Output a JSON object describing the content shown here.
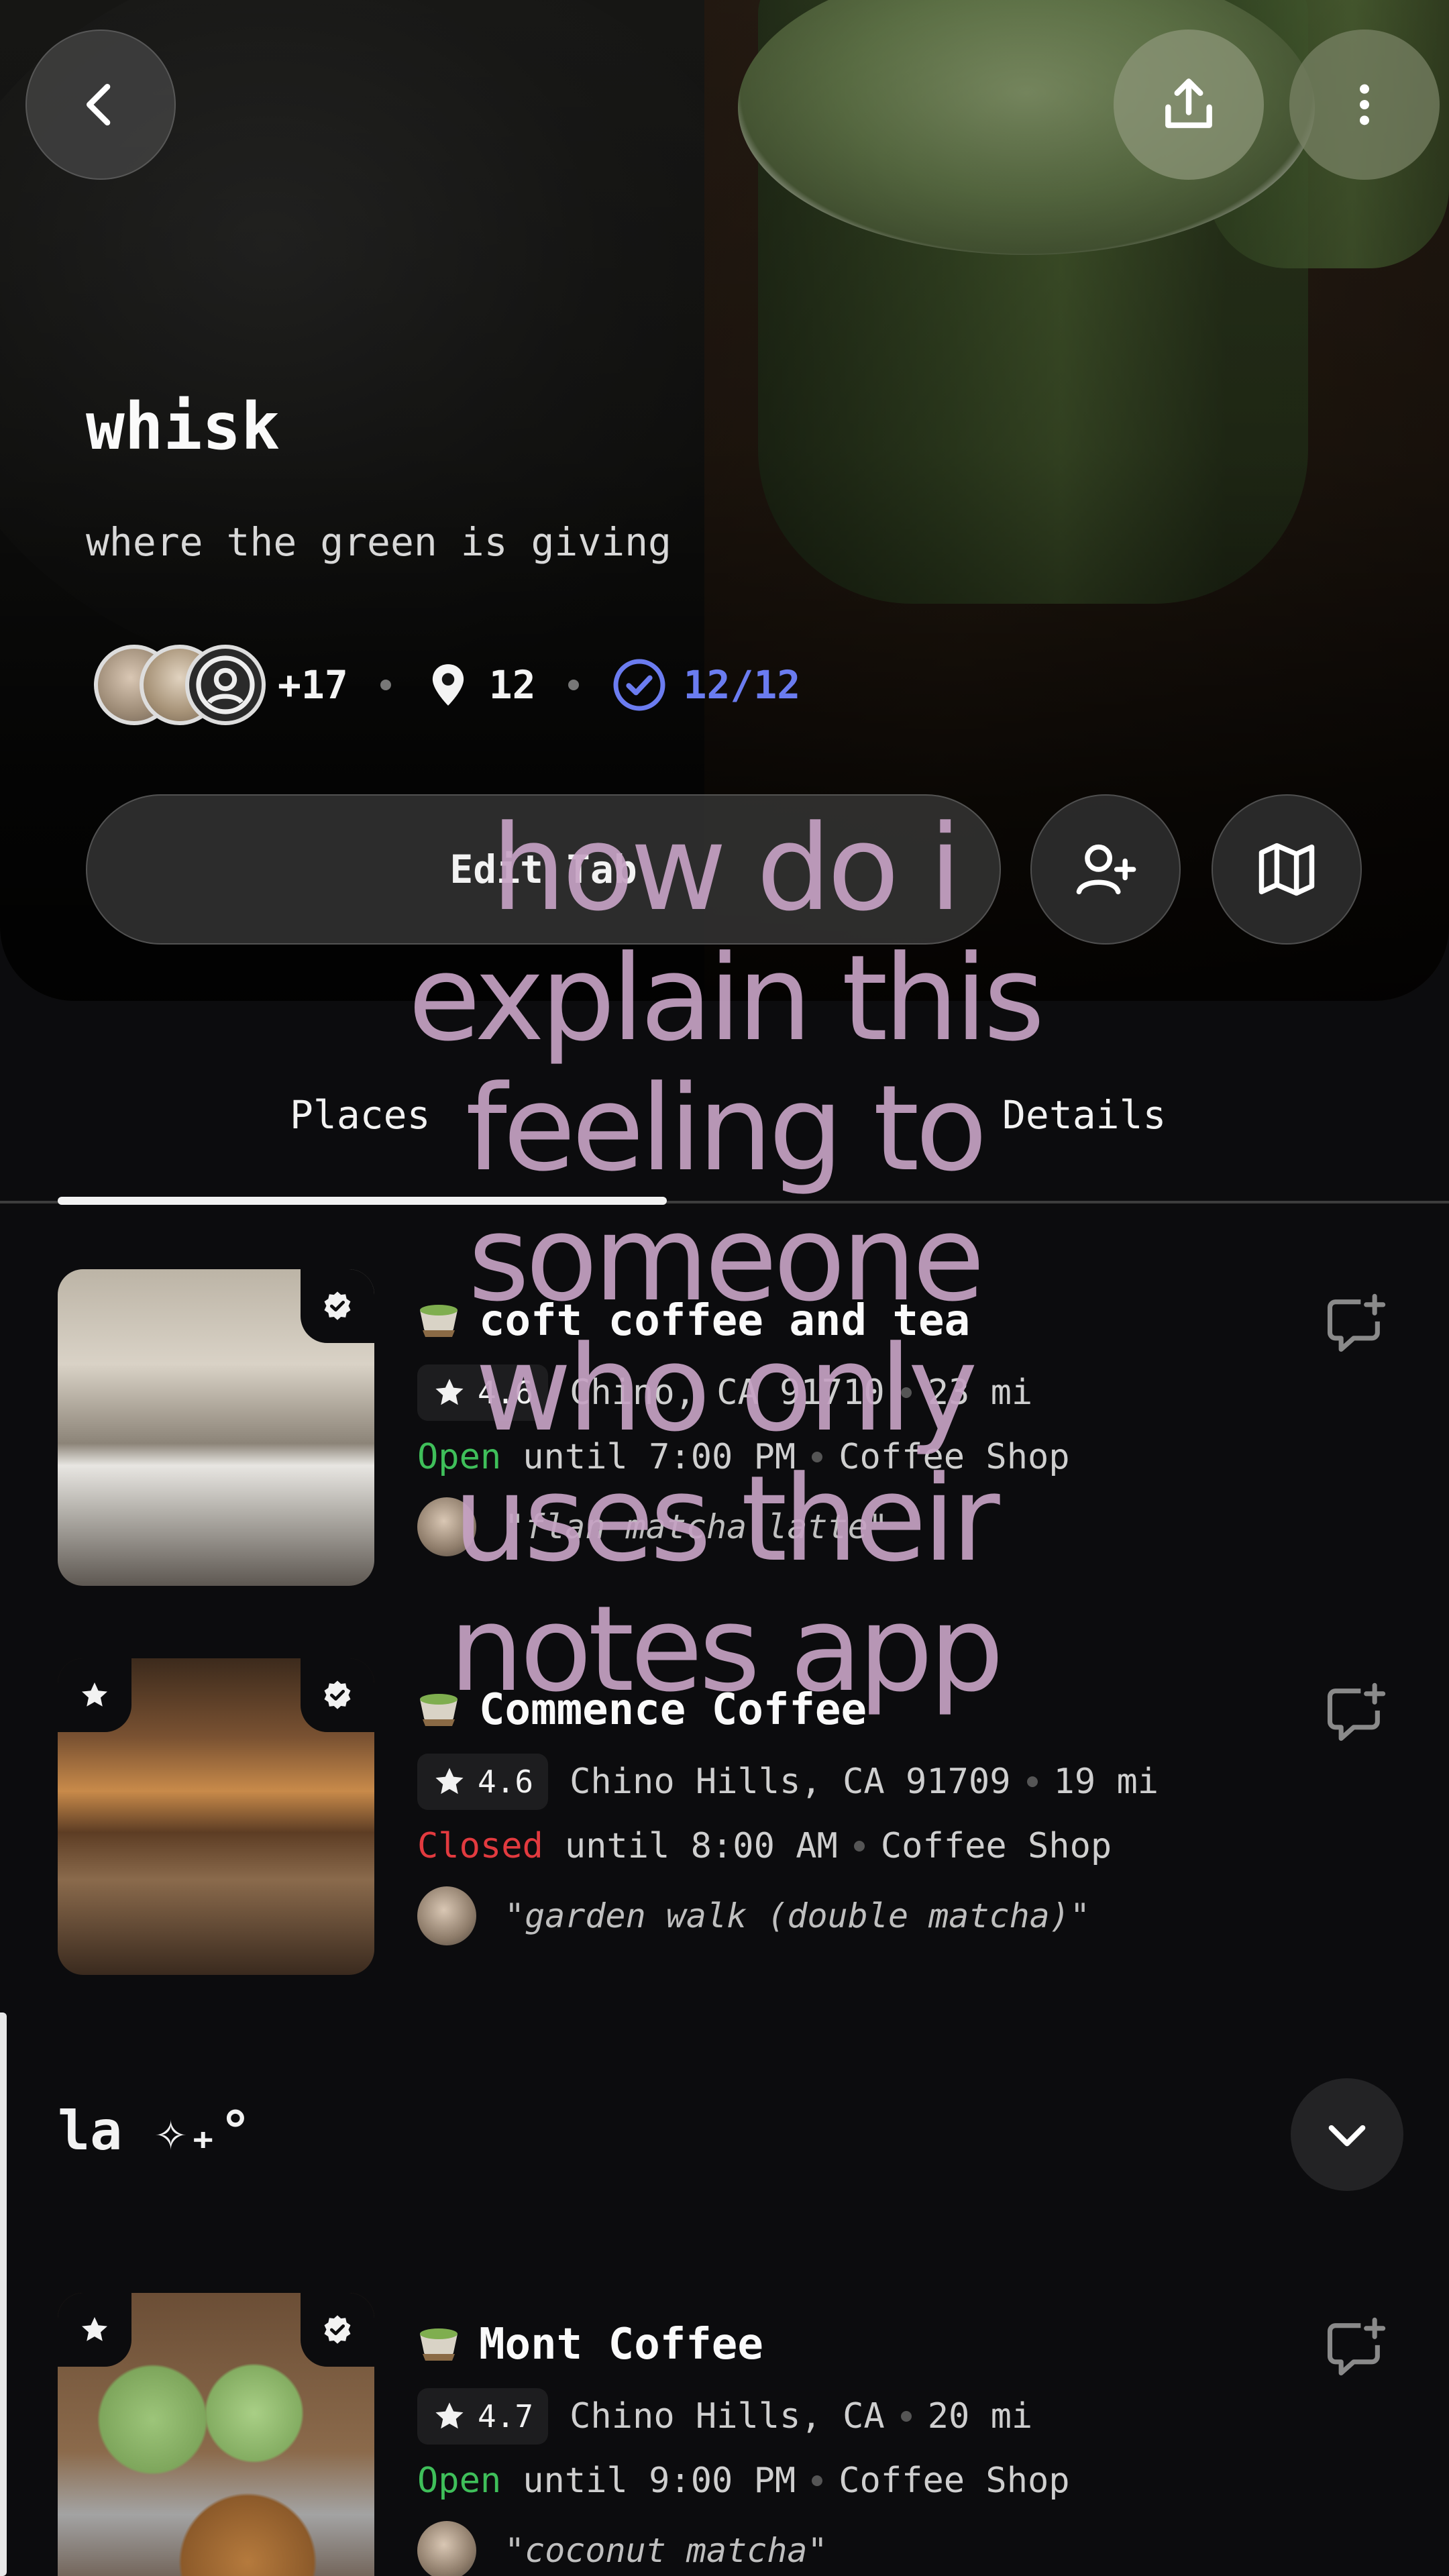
{
  "header": {
    "title": "whisk",
    "subtitle": "where the green is giving",
    "followers_extra": "+17",
    "places_count": "12",
    "visited": "12/12",
    "edit_button": "Edit Tab"
  },
  "tabs": [
    {
      "label": "Places"
    },
    {
      "label": "Details"
    }
  ],
  "places": [
    {
      "name": "coft coffee and tea",
      "rating": "4.6",
      "location": "Chino, CA 91710",
      "distance": "23 mi",
      "status": "Open",
      "hours": "until 7:00 PM",
      "category": "Coffee Shop",
      "note": "\"flan matcha latte\""
    },
    {
      "name": "Commence Coffee",
      "rating": "4.6",
      "location": "Chino Hills, CA 91709",
      "distance": "19 mi",
      "status": "Closed",
      "hours": "until 8:00 AM",
      "category": "Coffee Shop",
      "note": "\"garden walk (double matcha)\""
    },
    {
      "name": "Mont Coffee",
      "rating": "4.7",
      "location": "Chino Hills, CA",
      "distance": "20 mi",
      "status": "Open",
      "hours": "until 9:00 PM",
      "category": "Coffee Shop",
      "note": "\"coconut matcha\""
    }
  ],
  "section": {
    "title": "la ✧₊°"
  },
  "overlay": {
    "caption": "how do i\nexplain this\nfeeling to\nsomeone\nwho only\nuses their\nnotes app"
  },
  "colors": {
    "open": "#3fbf5a",
    "closed": "#e23a3f",
    "visited_blue": "#6b7cf0",
    "caption": "#c6a2c4"
  },
  "icons": [
    "back-arrow-icon",
    "share-icon",
    "more-vertical-icon",
    "location-pin-icon",
    "check-circle-icon",
    "add-person-icon",
    "map-icon",
    "star-icon",
    "matcha-cup-icon",
    "add-comment-icon",
    "chevron-down-icon",
    "visited-check-icon",
    "favorite-star-icon"
  ]
}
